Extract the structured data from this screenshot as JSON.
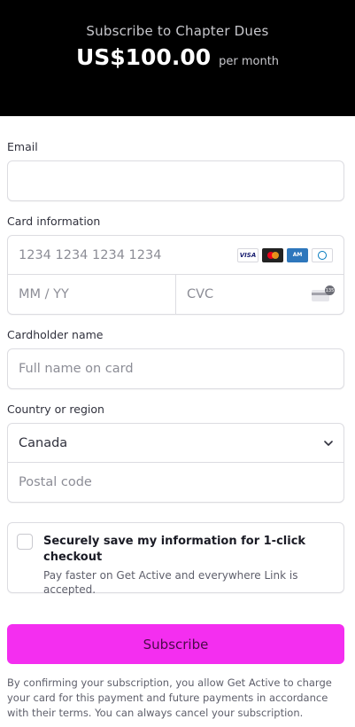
{
  "header": {
    "title": "Subscribe to Chapter Dues",
    "price": "US$100.00",
    "period": "per month"
  },
  "email": {
    "label": "Email",
    "value": ""
  },
  "card": {
    "label": "Card information",
    "number_placeholder": "1234 1234 1234 1234",
    "expiry_placeholder": "MM / YY",
    "cvc_placeholder": "CVC",
    "brands": [
      "VISA",
      "Mastercard",
      "AMEX",
      "Diners"
    ],
    "cvc_badge": "135"
  },
  "cardholder": {
    "label": "Cardholder name",
    "placeholder": "Full name on card"
  },
  "country": {
    "label": "Country or region",
    "selected": "Canada",
    "postal_placeholder": "Postal code"
  },
  "link": {
    "title": "Securely save my information for 1-click checkout",
    "description": "Pay faster on Get Active and everywhere Link is accepted.",
    "checked": false
  },
  "subscribe_label": "Subscribe",
  "terms": "By confirming your subscription, you allow Get Active to charge your card for this payment and future payments in accordance with their terms. You can always cancel your subscription.",
  "colors": {
    "header_bg": "#000000",
    "button_bg": "#f42ef0"
  }
}
